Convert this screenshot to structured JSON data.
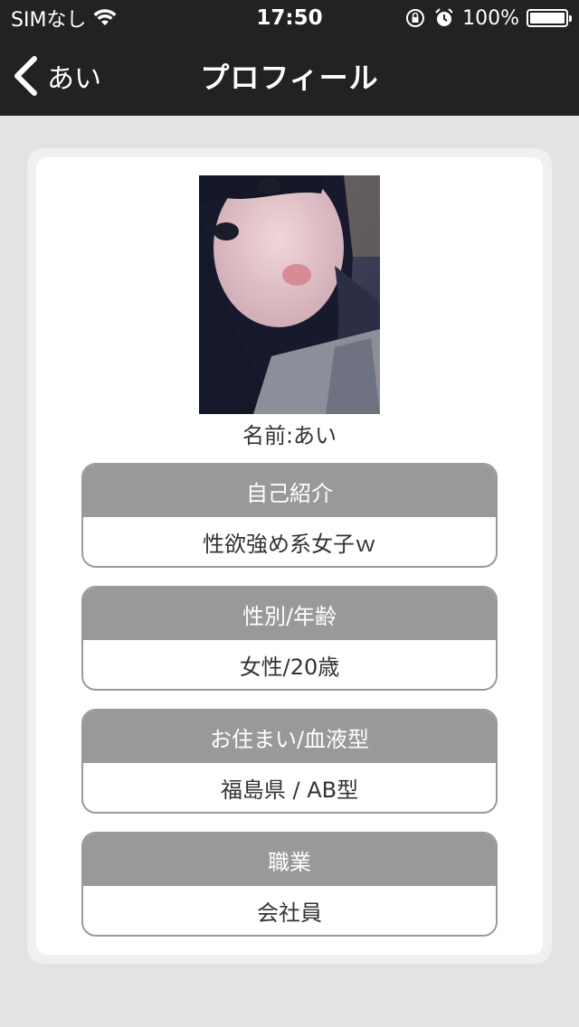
{
  "status_bar": {
    "carrier": "SIMなし",
    "time": "17:50",
    "battery": "100%"
  },
  "nav": {
    "back_label": "あい",
    "title": "プロフィール"
  },
  "profile": {
    "name_label": "名前:あい",
    "sections": [
      {
        "header": "自己紹介",
        "value": "性欲強め系女子ｗ"
      },
      {
        "header": "性別/年齢",
        "value": "女性/20歳"
      },
      {
        "header": "お住まい/血液型",
        "value": "福島県 / AB型"
      },
      {
        "header": "職業",
        "value": "会社員"
      }
    ]
  },
  "colors": {
    "bar": "#222222",
    "background": "#e3e3e3",
    "section_header": "#999999"
  }
}
